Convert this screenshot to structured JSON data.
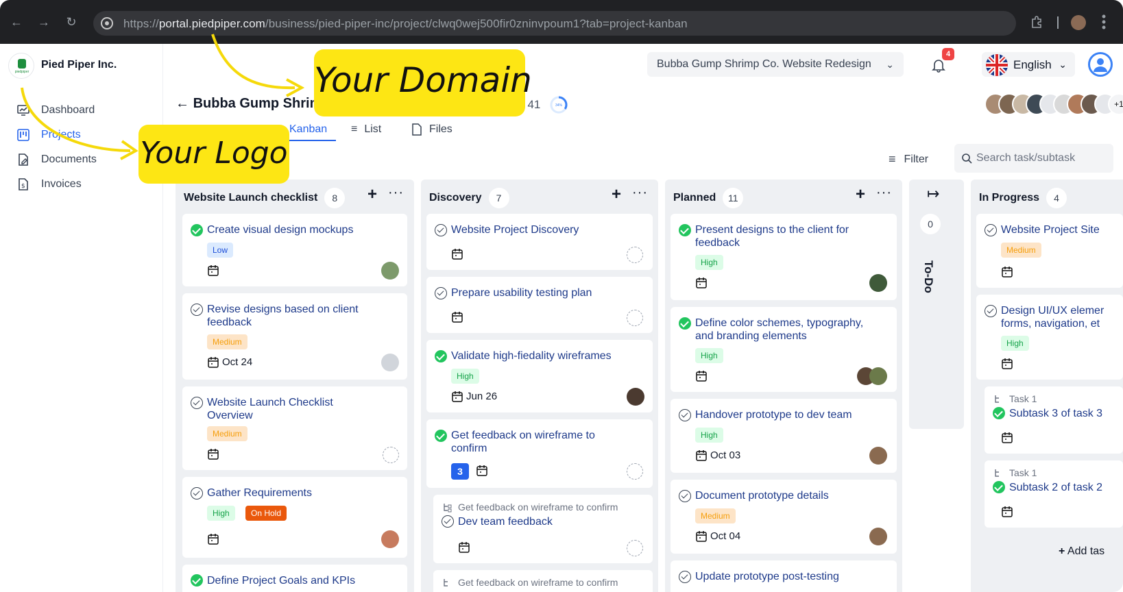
{
  "browser": {
    "url_prefix": "https://",
    "url_domain": "portal.piedpiper.com",
    "url_path": "/business/pied-piper-inc/project/clwq0wej500fir0zninvpoum1?tab=project-kanban"
  },
  "sidebar": {
    "org_name": "Pied Piper Inc.",
    "logo_text": "piedpiper",
    "items": [
      {
        "label": "Dashboard",
        "icon": "dashboard-icon"
      },
      {
        "label": "Projects",
        "icon": "projects-icon"
      },
      {
        "label": "Documents",
        "icon": "documents-icon"
      },
      {
        "label": "Invoices",
        "icon": "invoices-icon"
      }
    ]
  },
  "header": {
    "project_selector": "Bubba Gump Shrimp Co. Website Redesign",
    "notifications_count": "4",
    "language": "English",
    "project_title": "Bubba Gump Shrimp",
    "task_count": "/ 41",
    "progress_label": "34%",
    "progress_value": 0.34,
    "members_extra": "+1",
    "tabs": [
      "Kanban",
      "List",
      "Files"
    ],
    "filter_label": "Filter",
    "search_placeholder": "Search task/subtask"
  },
  "annotations": {
    "domain_note": "Your Domain",
    "logo_note": "Your Logo"
  },
  "board": {
    "columns": [
      {
        "title": "Website Launch checklist",
        "count": "8"
      },
      {
        "title": "Discovery",
        "count": "7"
      },
      {
        "title": "Planned",
        "count": "11"
      },
      {
        "title": "To-Do",
        "count": "0"
      },
      {
        "title": "In Progress",
        "count": "4"
      }
    ],
    "col1": [
      {
        "title": "Create visual design mockups",
        "priority": "Low"
      },
      {
        "title": "Revise designs based on client",
        "title2": "feedback",
        "priority": "Medium",
        "date": "Oct 24"
      },
      {
        "title": "Website Launch Checklist",
        "title2": "Overview",
        "priority": "Medium"
      },
      {
        "title": "Gather Requirements",
        "priority": "High",
        "status": "On Hold"
      },
      {
        "title": "Define Project Goals and KPIs"
      }
    ],
    "col2": [
      {
        "title": "Website Project Discovery"
      },
      {
        "title": "Prepare usability testing plan"
      },
      {
        "title": "Validate high-fiedality wireframes",
        "priority": "High",
        "date": "Jun 26"
      },
      {
        "title": "Get feedback on wireframe to",
        "title2": "confirm",
        "subtasks": "3"
      },
      {
        "parent": "Get feedback on wireframe to confirm",
        "title": "Dev team feedback"
      },
      {
        "parent": "Get feedback on wireframe to confirm"
      }
    ],
    "col3": [
      {
        "title": "Present designs to the client for",
        "title2": "feedback",
        "priority": "High"
      },
      {
        "title": "Define color schemes, typography,",
        "title2": "and branding elements",
        "priority": "High"
      },
      {
        "title": "Handover prototype to dev team",
        "priority": "High",
        "date": "Oct 03"
      },
      {
        "title": "Document prototype details",
        "priority": "Medium",
        "date": "Oct 04"
      },
      {
        "title": "Update prototype post-testing"
      }
    ],
    "col5": [
      {
        "title": "Website Project Site",
        "priority": "Medium"
      },
      {
        "title": "Design UI/UX elemer",
        "title2": "forms, navigation, et",
        "priority": "High"
      },
      {
        "parent": "Task 1",
        "title": "Subtask 3 of task 3"
      },
      {
        "parent": "Task 1",
        "title": "Subtask 2 of task 2"
      }
    ],
    "add_task": "Add tas"
  }
}
